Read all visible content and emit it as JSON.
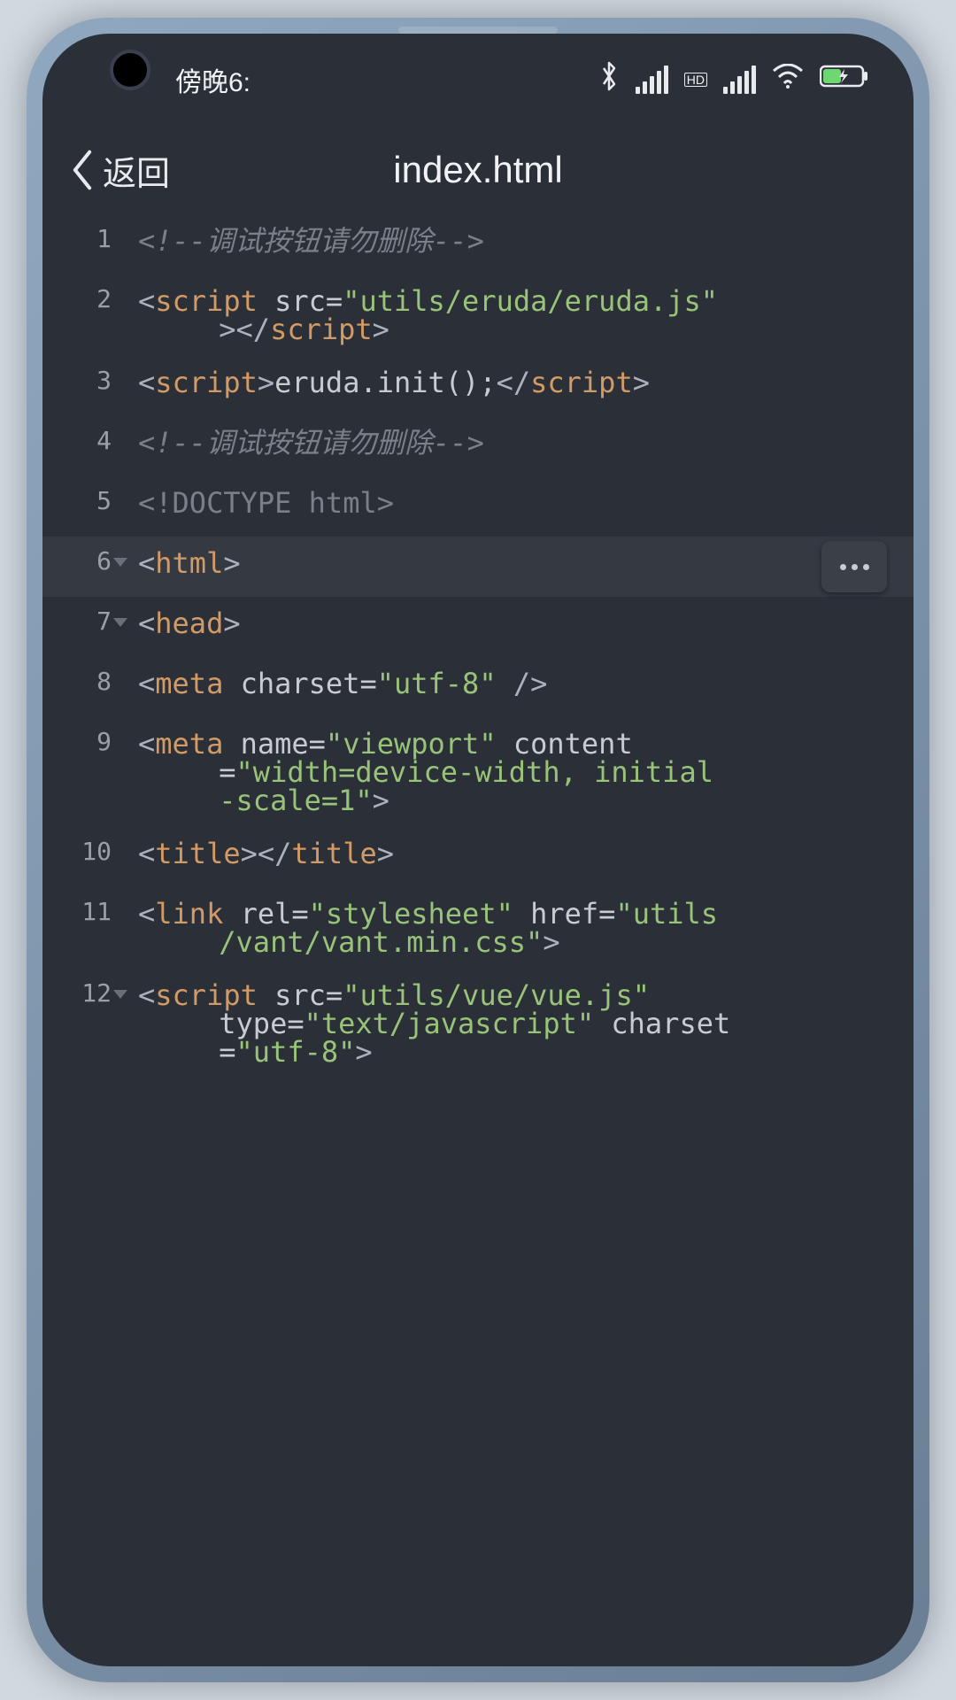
{
  "status": {
    "time_label": "傍晚6:",
    "bluetooth": "bluetooth-icon",
    "signal": "signal-icon",
    "hd": "HD",
    "signal2": "signal-icon",
    "wifi": "wifi-icon",
    "battery": "battery-charging-icon"
  },
  "nav": {
    "back_label": "返回",
    "title": "index.html"
  },
  "editor": {
    "lines": [
      {
        "n": "1",
        "fold": false,
        "active": false,
        "type": "comment",
        "text": "<!--调试按钮请勿删除-->"
      },
      {
        "n": "2",
        "fold": false,
        "active": false,
        "type": "code",
        "html": [
          [
            "bracket",
            "<"
          ],
          [
            "tag",
            "script"
          ],
          [
            "attr",
            " src="
          ],
          [
            "string",
            "\"utils/eruda/eruda.js\""
          ]
        ],
        "wrap": [
          [
            "bracket",
            " >"
          ],
          [
            "bracket",
            "</"
          ],
          [
            "tag",
            "script"
          ],
          [
            "bracket",
            ">"
          ]
        ]
      },
      {
        "n": "3",
        "fold": false,
        "active": false,
        "type": "code",
        "html": [
          [
            "bracket",
            "<"
          ],
          [
            "tag",
            "script"
          ],
          [
            "bracket",
            ">"
          ],
          [
            "func",
            "eruda.init();"
          ],
          [
            "bracket",
            "</"
          ],
          [
            "tag",
            "script"
          ],
          [
            "bracket",
            ">"
          ]
        ]
      },
      {
        "n": "4",
        "fold": false,
        "active": false,
        "type": "comment",
        "text": "<!--调试按钮请勿删除-->"
      },
      {
        "n": "5",
        "fold": false,
        "active": false,
        "type": "doctype",
        "text": "<!DOCTYPE html>"
      },
      {
        "n": "6",
        "fold": true,
        "active": true,
        "type": "code",
        "html": [
          [
            "bracket",
            "<"
          ],
          [
            "tag",
            "html"
          ],
          [
            "bracket",
            ">"
          ]
        ]
      },
      {
        "n": "7",
        "fold": true,
        "active": false,
        "type": "code",
        "html": [
          [
            "bracket",
            "<"
          ],
          [
            "tag",
            "head"
          ],
          [
            "bracket",
            ">"
          ]
        ]
      },
      {
        "n": "8",
        "fold": false,
        "active": false,
        "type": "code",
        "html": [
          [
            "bracket",
            "<"
          ],
          [
            "tag",
            "meta"
          ],
          [
            "attr",
            " charset="
          ],
          [
            "string",
            "\"utf-8\""
          ],
          [
            "bracket",
            " />"
          ]
        ]
      },
      {
        "n": "9",
        "fold": false,
        "active": false,
        "type": "code",
        "html": [
          [
            "bracket",
            "<"
          ],
          [
            "tag",
            "meta"
          ],
          [
            "attr",
            " name="
          ],
          [
            "string",
            "\"viewport\""
          ],
          [
            "attr",
            " content"
          ]
        ],
        "wrap": [
          [
            "attr",
            " ="
          ],
          [
            "string",
            "\"width=device-width, initial"
          ]
        ],
        "wrap2": [
          [
            "string",
            " -scale=1\""
          ],
          [
            "bracket",
            ">"
          ]
        ]
      },
      {
        "n": "10",
        "fold": false,
        "active": false,
        "type": "code",
        "html": [
          [
            "bracket",
            "<"
          ],
          [
            "tag",
            "title"
          ],
          [
            "bracket",
            ">"
          ],
          [
            "bracket",
            "</"
          ],
          [
            "tag",
            "title"
          ],
          [
            "bracket",
            ">"
          ]
        ]
      },
      {
        "n": "11",
        "fold": false,
        "active": false,
        "type": "code",
        "html": [
          [
            "bracket",
            "<"
          ],
          [
            "tag",
            "link"
          ],
          [
            "attr",
            " rel="
          ],
          [
            "string",
            "\"stylesheet\""
          ],
          [
            "attr",
            " href="
          ],
          [
            "string",
            "\"utils"
          ]
        ],
        "wrap": [
          [
            "string",
            " /vant/vant.min.css\""
          ],
          [
            "bracket",
            ">"
          ]
        ]
      },
      {
        "n": "12",
        "fold": true,
        "active": false,
        "type": "code",
        "html": [
          [
            "bracket",
            "<"
          ],
          [
            "tag",
            "script"
          ],
          [
            "attr",
            " src="
          ],
          [
            "string",
            "\"utils/vue/vue.js\""
          ]
        ],
        "wrap": [
          [
            "attr",
            " type="
          ],
          [
            "string",
            "\"text/javascript\""
          ],
          [
            "attr",
            " charset"
          ]
        ],
        "wrap2": [
          [
            "attr",
            " ="
          ],
          [
            "string",
            "\"utf-8\""
          ],
          [
            "bracket",
            ">"
          ]
        ]
      }
    ]
  },
  "more_button": "..."
}
